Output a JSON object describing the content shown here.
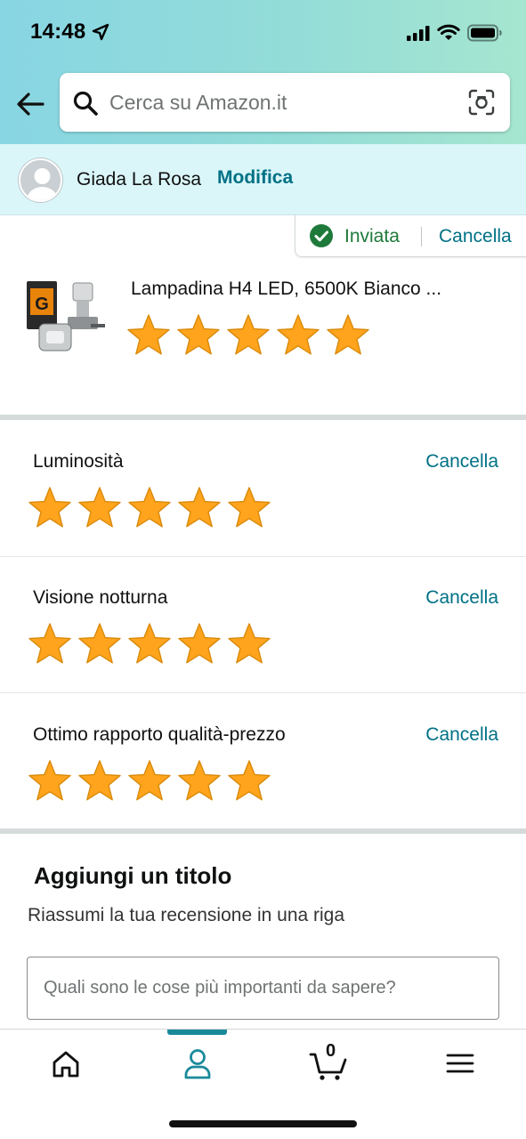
{
  "status_bar": {
    "time": "14:48",
    "icons": [
      "location-arrow-icon",
      "cellular-signal-icon",
      "wifi-icon",
      "battery-icon"
    ]
  },
  "header": {
    "search_placeholder": "Cerca su Amazon.it",
    "back_icon": "back-arrow-icon",
    "search_icon": "magnifier-icon",
    "camera_icon": "camera-scan-icon"
  },
  "user": {
    "name": "Giada La Rosa",
    "edit_label": "Modifica"
  },
  "submission": {
    "status_label": "Inviata",
    "cancel_label": "Cancella"
  },
  "product": {
    "title": "Lampadina H4 LED, 6500K Bianco ...",
    "rating": 5,
    "max_rating": 5
  },
  "criteria": [
    {
      "label": "Luminosità",
      "cancel_label": "Cancella",
      "rating": 5
    },
    {
      "label": "Visione notturna",
      "cancel_label": "Cancella",
      "rating": 5
    },
    {
      "label": "Ottimo rapporto qualità-prezzo",
      "cancel_label": "Cancella",
      "rating": 5
    }
  ],
  "review_title": {
    "heading": "Aggiungi un titolo",
    "subheading": "Riassumi la tua recensione in una riga",
    "placeholder": "Quali sono le cose più importanti da sapere?"
  },
  "bottom_nav": {
    "items": [
      "home-icon",
      "account-icon",
      "cart-icon",
      "menu-icon"
    ],
    "active": "account-icon",
    "cart_count": "0"
  },
  "colors": {
    "link": "#007185",
    "star": "#ffa41c",
    "success": "#1e7a3a",
    "header_gradient_start": "#88d6e3",
    "header_gradient_end": "#a6e6d0",
    "user_bar": "#daf6f9",
    "nav_active": "#1a8a9b"
  }
}
